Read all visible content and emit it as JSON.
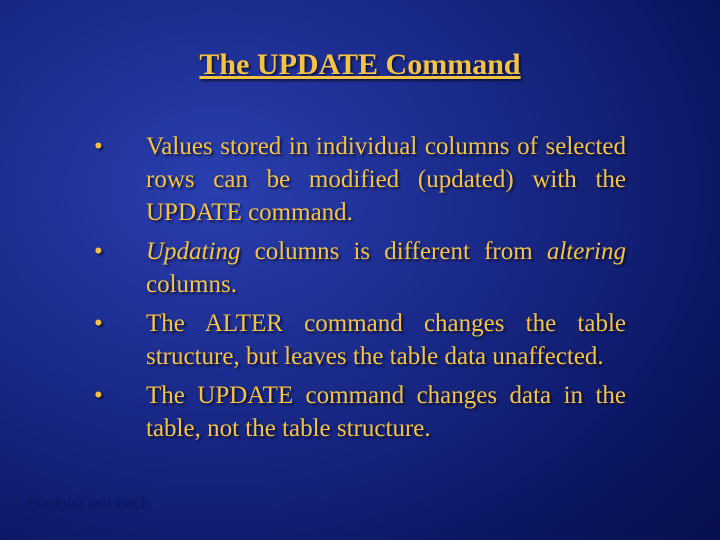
{
  "slide": {
    "title": "The UPDATE Command",
    "bullets": {
      "b1": "Values stored in individual columns of selected rows can be modified (updated) with the UPDATE command.",
      "b2_pre": "Updating",
      "b2_mid": " columns is different from ",
      "b2_em": "altering",
      "b2_post": " columns.",
      "b3": "The ALTER command changes the table structure, but leaves the table data unaffected.",
      "b4": "The UPDATE command changes data in the table, not the table structure."
    },
    "marker": "•"
  },
  "footer": {
    "text": "Bordoloi and Bock"
  }
}
